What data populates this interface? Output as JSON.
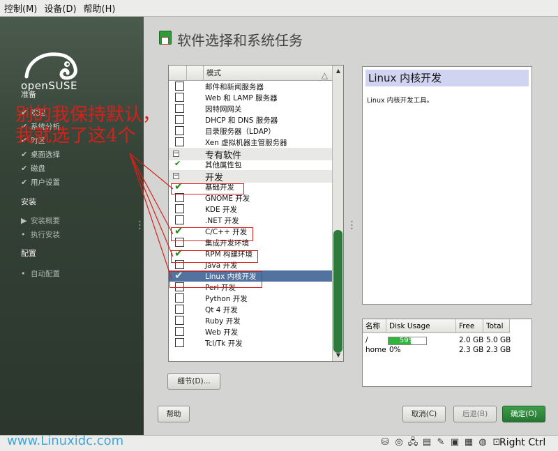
{
  "menubar": [
    {
      "label": "控制(M)"
    },
    {
      "label": "设备(D)"
    },
    {
      "label": "帮助(H)"
    }
  ],
  "sidebar": {
    "logo_text": "openSUSE",
    "sections": {
      "prepare": "准备",
      "install": "安装",
      "config": "配置"
    },
    "steps_prepare": [
      "欢迎",
      "系统分析",
      "时区",
      "桌面选择",
      "磁盘",
      "用户设置"
    ],
    "steps_install": [
      "安装概要",
      "执行安装"
    ],
    "steps_config": [
      "自动配置"
    ]
  },
  "page": {
    "title": "软件选择和系统任务"
  },
  "list": {
    "header": "模式",
    "rows": [
      {
        "label": "邮件和新闻服务器",
        "state": "unchecked",
        "kind": "item"
      },
      {
        "label": "Web 和 LAMP 服务器",
        "state": "unchecked",
        "kind": "item"
      },
      {
        "label": "因特网网关",
        "state": "unchecked",
        "kind": "item"
      },
      {
        "label": "DHCP 和 DNS 服务器",
        "state": "unchecked",
        "kind": "item"
      },
      {
        "label": "目录服务器（LDAP）",
        "state": "unchecked",
        "kind": "item"
      },
      {
        "label": "Xen 虚拟机器主管服务器",
        "state": "unchecked",
        "kind": "item"
      },
      {
        "label": "专有软件",
        "state": "",
        "kind": "group"
      },
      {
        "label": "其他属性包",
        "state": "partial",
        "kind": "item"
      },
      {
        "label": "开发",
        "state": "",
        "kind": "group"
      },
      {
        "label": "基础开发",
        "state": "checked",
        "kind": "item"
      },
      {
        "label": "GNOME 开发",
        "state": "unchecked",
        "kind": "item"
      },
      {
        "label": "KDE 开发",
        "state": "unchecked",
        "kind": "item"
      },
      {
        "label": ".NET 开发",
        "state": "unchecked",
        "kind": "item"
      },
      {
        "label": "C/C++ 开发",
        "state": "checked",
        "kind": "item"
      },
      {
        "label": "集成开发环境",
        "state": "unchecked",
        "kind": "item"
      },
      {
        "label": "RPM 构建环境",
        "state": "checked",
        "kind": "item"
      },
      {
        "label": "Java 开发",
        "state": "unchecked",
        "kind": "item"
      },
      {
        "label": "Linux 内核开发",
        "state": "checked",
        "kind": "item",
        "selected": true
      },
      {
        "label": "Perl 开发",
        "state": "unchecked",
        "kind": "item"
      },
      {
        "label": "Python 开发",
        "state": "unchecked",
        "kind": "item"
      },
      {
        "label": "Qt 4 开发",
        "state": "unchecked",
        "kind": "item"
      },
      {
        "label": "Ruby 开发",
        "state": "unchecked",
        "kind": "item"
      },
      {
        "label": "Web 开发",
        "state": "unchecked",
        "kind": "item"
      },
      {
        "label": "Tcl/Tk 开发",
        "state": "unchecked",
        "kind": "item"
      }
    ]
  },
  "description": {
    "title": "Linux 内核开发",
    "text": "Linux 内核开发工具。"
  },
  "disk": {
    "headers": [
      "名称",
      "Disk Usage",
      "Free",
      "Total"
    ],
    "rows": [
      {
        "name": "/",
        "usage": "59%",
        "usage_fraction": 0.59,
        "free": "2.0 GB",
        "total": "5.0 GB"
      },
      {
        "name": "home",
        "usage": "0%",
        "usage_fraction": 0,
        "free": "2.3 GB",
        "total": "2.3 GB"
      }
    ]
  },
  "buttons": {
    "details": "细节(D)...",
    "help": "帮助",
    "cancel": "取消(C)",
    "back": "后退(B)",
    "ok": "确定(O)"
  },
  "annotation": {
    "line1": "别的我保持默认，",
    "line2": "我就选了这4个"
  },
  "status": {
    "watermark": "www.Linuxidc.com",
    "right_ctrl": "Right Ctrl"
  },
  "colors": {
    "accent_green": "#2d7a3a",
    "selection": "#5272a0",
    "annotation_red": "#d8201a"
  }
}
